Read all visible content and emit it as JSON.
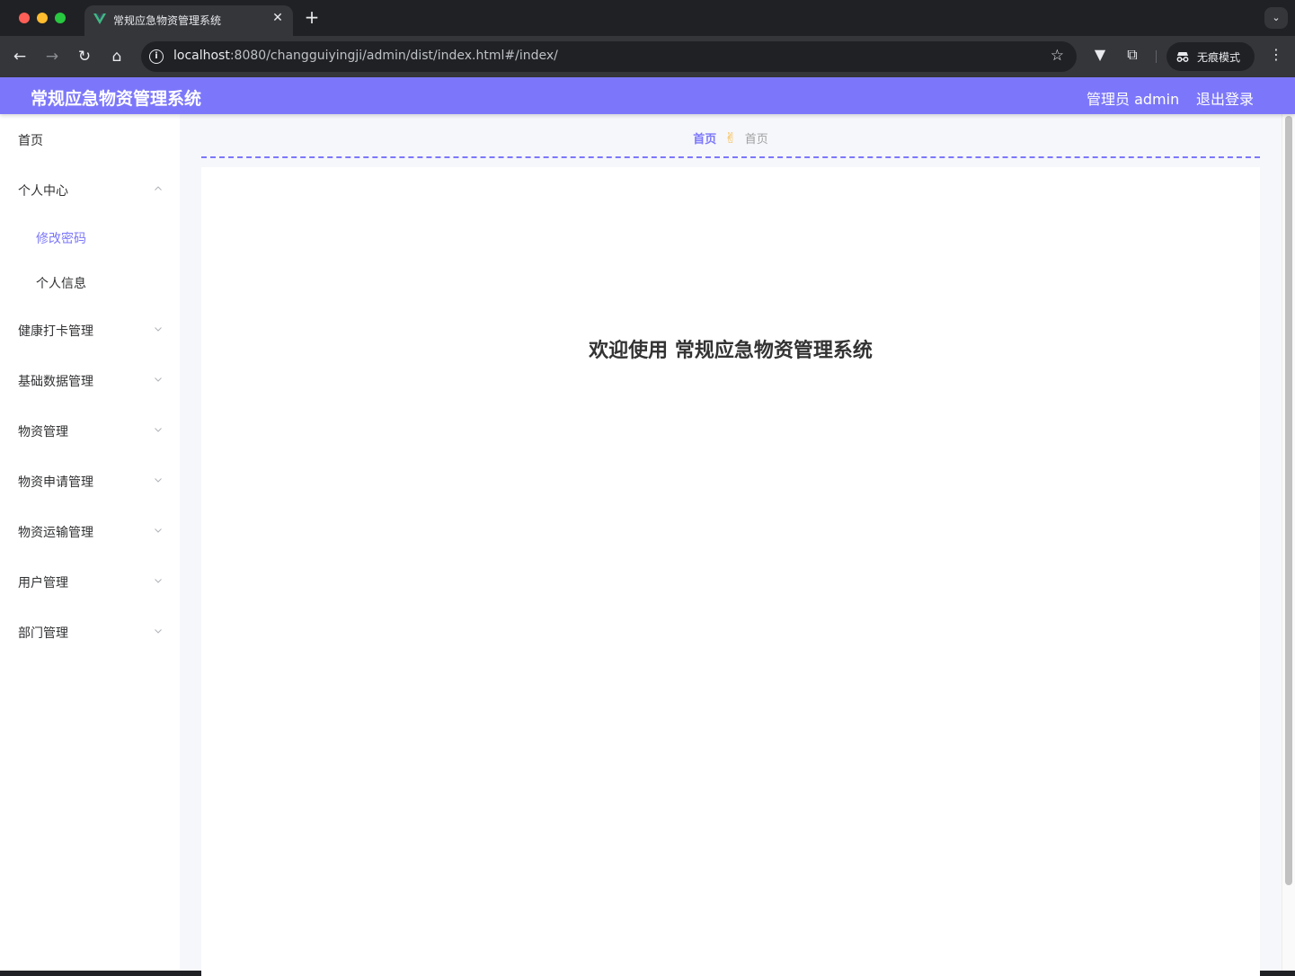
{
  "browser": {
    "tab_title": "常规应急物资管理系统",
    "tab_close": "✕",
    "new_tab": "+",
    "url_host": "localhost",
    "url_rest": ":8080/changguiyingji/admin/dist/index.html#/index/",
    "incognito_label": "无痕模式"
  },
  "header": {
    "title": "常规应急物资管理系统",
    "user": "管理员 admin",
    "logout": "退出登录"
  },
  "sidebar": {
    "items": [
      {
        "label": "首页"
      },
      {
        "label": "个人中心",
        "expanded": true
      },
      {
        "label": "修改密码",
        "active": true
      },
      {
        "label": "个人信息"
      },
      {
        "label": "健康打卡管理"
      },
      {
        "label": "基础数据管理"
      },
      {
        "label": "物资管理"
      },
      {
        "label": "物资申请管理"
      },
      {
        "label": "物资运输管理"
      },
      {
        "label": "用户管理"
      },
      {
        "label": "部门管理"
      }
    ]
  },
  "breadcrumb": {
    "home": "首页",
    "separator": "✌",
    "current": "首页"
  },
  "main": {
    "welcome": "欢迎使用 常规应急物资管理系统"
  },
  "colors": {
    "accent": "#7c77fa",
    "header_bg": "#7c77fa",
    "page_bg": "#f6f7fb"
  }
}
